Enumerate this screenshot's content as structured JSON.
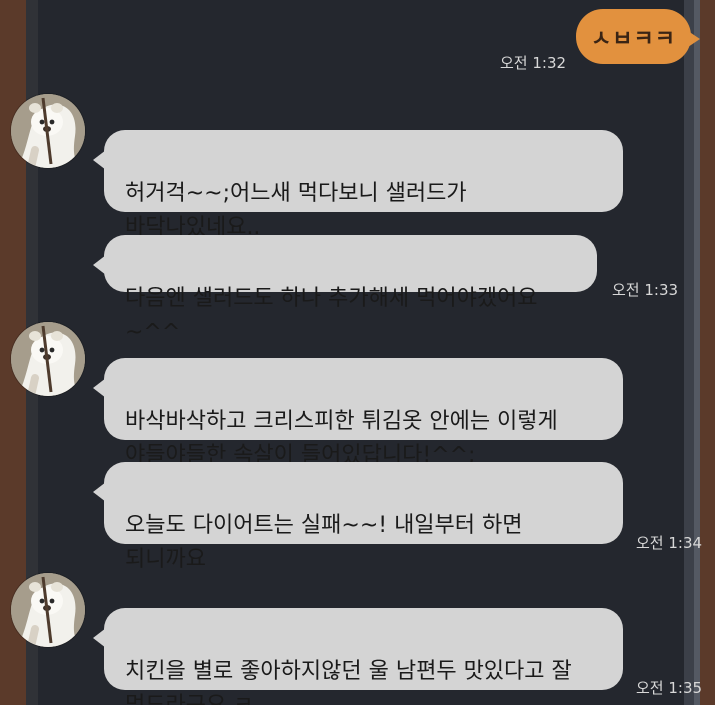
{
  "messages": {
    "sent": {
      "text": "ㅅㅂㅋㅋ",
      "time": "오전 1:32"
    },
    "received": [
      {
        "text": "허거걱~~;어느새 먹다보니 샐러드가\n바닥나있네요..",
        "time": ""
      },
      {
        "text": "다음엔 샐러드도 하나 추가해세 먹어야겠어요~^^",
        "time": "오전 1:33"
      },
      {
        "text": "바삭바삭하고 크리스피한 튀김옷 안에는 이렇게\n야들야들한 속살이 들어있답니다!^^;",
        "time": ""
      },
      {
        "text": "오늘도 다이어트는 실패~~! 내일부터 하면\n되니까요",
        "time": "오전 1:34"
      },
      {
        "text": "치킨을 별로 좋아하지않던 울 남편두 맛있다고 잘\n먹드라구요 ㅋ",
        "time": "오전 1:35"
      }
    ]
  },
  "avatar": {
    "icon": "polar-bear-plush-icon"
  },
  "colors": {
    "chat_background": "#24272e",
    "received_bubble": "#d4d4d4",
    "sent_bubble": "#e2913e",
    "time_text": "#d8d8d8",
    "frame_wood": "#5b3a2a"
  }
}
